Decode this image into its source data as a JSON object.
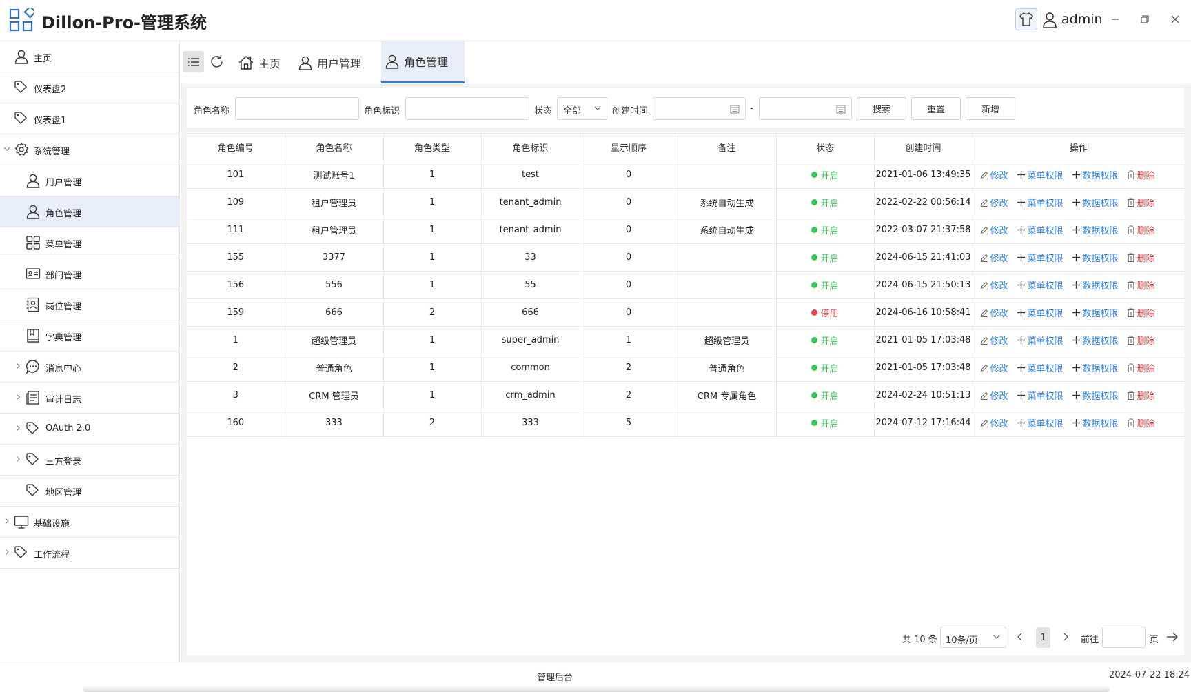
{
  "header": {
    "title": "Dillon-Pro-管理系统",
    "user": "admin"
  },
  "sidebar": {
    "items": [
      {
        "label": "主页",
        "icon": "user-icon"
      },
      {
        "label": "仪表盘2",
        "icon": "tag-icon"
      },
      {
        "label": "仪表盘1",
        "icon": "tag-icon"
      },
      {
        "label": "系统管理",
        "icon": "gear-icon",
        "expanded": true
      },
      {
        "label": "用户管理",
        "icon": "user-icon"
      },
      {
        "label": "角色管理",
        "icon": "user-icon",
        "active": true
      },
      {
        "label": "菜单管理",
        "icon": "grid-icon"
      },
      {
        "label": "部门管理",
        "icon": "id-card-icon"
      },
      {
        "label": "岗位管理",
        "icon": "contact-icon"
      },
      {
        "label": "字典管理",
        "icon": "book-icon"
      },
      {
        "label": "消息中心",
        "icon": "chat-icon"
      },
      {
        "label": "审计日志",
        "icon": "document-icon"
      },
      {
        "label": "OAuth 2.0",
        "icon": "tag-icon"
      },
      {
        "label": "三方登录",
        "icon": "tag-icon"
      },
      {
        "label": "地区管理",
        "icon": "tag-icon"
      },
      {
        "label": "基础设施",
        "icon": "monitor-icon"
      },
      {
        "label": "工作流程",
        "icon": "tag-icon"
      }
    ]
  },
  "tabs": [
    {
      "label": "主页",
      "icon": "home-icon"
    },
    {
      "label": "用户管理",
      "icon": "user-icon"
    },
    {
      "label": "角色管理",
      "icon": "user-icon",
      "active": true
    }
  ],
  "search": {
    "role_name_label": "角色名称",
    "role_key_label": "角色标识",
    "status_label": "状态",
    "status_value": "全部",
    "created_label": "创建时间",
    "date_sep": "-",
    "search_btn": "搜索",
    "reset_btn": "重置",
    "add_btn": "新增"
  },
  "table": {
    "headers": [
      "角色编号",
      "角色名称",
      "角色类型",
      "角色标识",
      "显示顺序",
      "备注",
      "状态",
      "创建时间",
      "操作"
    ],
    "rows": [
      {
        "id": "101",
        "name": "测试账号1",
        "type": "1",
        "key": "test",
        "order": "0",
        "remark": "",
        "status": "开启",
        "on": true,
        "created": "2021-01-06 13:49:35"
      },
      {
        "id": "109",
        "name": "租户管理员",
        "type": "1",
        "key": "tenant_admin",
        "order": "0",
        "remark": "系统自动生成",
        "status": "开启",
        "on": true,
        "created": "2022-02-22 00:56:14"
      },
      {
        "id": "111",
        "name": "租户管理员",
        "type": "1",
        "key": "tenant_admin",
        "order": "0",
        "remark": "系统自动生成",
        "status": "开启",
        "on": true,
        "created": "2022-03-07 21:37:58"
      },
      {
        "id": "155",
        "name": "3377",
        "type": "1",
        "key": "33",
        "order": "0",
        "remark": "",
        "status": "开启",
        "on": true,
        "created": "2024-06-15 21:41:03"
      },
      {
        "id": "156",
        "name": "556",
        "type": "1",
        "key": "55",
        "order": "0",
        "remark": "",
        "status": "开启",
        "on": true,
        "created": "2024-06-15 21:50:13"
      },
      {
        "id": "159",
        "name": "666",
        "type": "2",
        "key": "666",
        "order": "0",
        "remark": "",
        "status": "停用",
        "on": false,
        "created": "2024-06-16 10:58:41"
      },
      {
        "id": "1",
        "name": "超级管理员",
        "type": "1",
        "key": "super_admin",
        "order": "1",
        "remark": "超级管理员",
        "status": "开启",
        "on": true,
        "created": "2021-01-05 17:03:48"
      },
      {
        "id": "2",
        "name": "普通角色",
        "type": "1",
        "key": "common",
        "order": "2",
        "remark": "普通角色",
        "status": "开启",
        "on": true,
        "created": "2021-01-05 17:03:48"
      },
      {
        "id": "3",
        "name": "CRM 管理员",
        "type": "1",
        "key": "crm_admin",
        "order": "2",
        "remark": "CRM 专属角色",
        "status": "开启",
        "on": true,
        "created": "2024-02-24 10:51:13"
      },
      {
        "id": "160",
        "name": "333",
        "type": "2",
        "key": "333",
        "order": "5",
        "remark": "",
        "status": "开启",
        "on": true,
        "created": "2024-07-12 17:16:44"
      }
    ],
    "actions": {
      "edit": "修改",
      "menu_perm": "菜单权限",
      "data_perm": "数据权限",
      "delete": "删除"
    }
  },
  "pager": {
    "total": "共 10 条",
    "size": "10条/页",
    "page": "1",
    "goto": "前往",
    "page_unit": "页"
  },
  "footer": {
    "center": "管理后台",
    "time": "2024-07-22 18:24"
  },
  "colors": {
    "accent": "#2f7de1",
    "active_bg": "#e8eef9",
    "on": "#3cc25b",
    "off": "#e5484d"
  }
}
